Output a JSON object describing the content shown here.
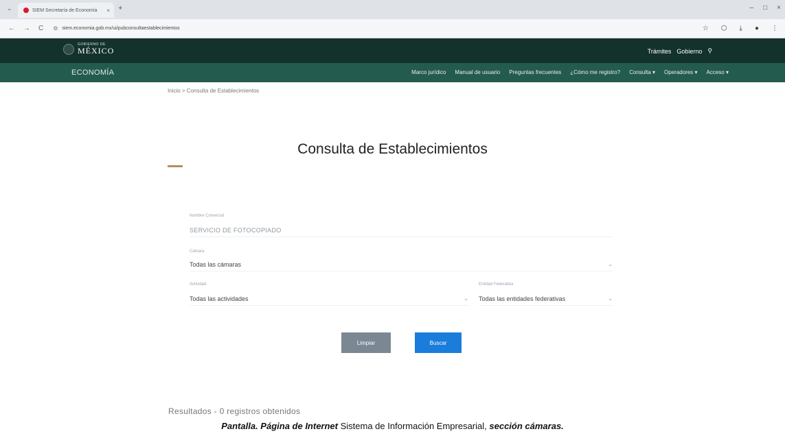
{
  "browser": {
    "tab_title": "SIEM Secretaría de Economía",
    "url": "siem.economia.gob.mx/ui/pubconsultaestablecimientos",
    "new_tab": "+",
    "tab_close": "×",
    "back": "←",
    "forward": "→",
    "reload": "C",
    "star": "☆",
    "extensions": "⬡",
    "download": "⤓",
    "profile": "●",
    "menu": "⋮",
    "min": "–",
    "max": "□",
    "close": "×"
  },
  "gov_header": {
    "logo_small": "GOBIERNO DE",
    "logo_big": "MÉXICO",
    "links": [
      "Trámites",
      "Gobierno"
    ],
    "search_icon": "⚲"
  },
  "subnav": {
    "brand": "ECONOMÍA",
    "menu": [
      "Marco jurídico",
      "Manual de usuario",
      "Preguntas frecuentes",
      "¿Cómo me registro?",
      "Consulta ▾",
      "Operadores ▾",
      "Acceso ▾"
    ]
  },
  "breadcrumb": "Inicio > Consulta de Establecimientos",
  "page_title": "Consulta de Establecimientos",
  "form": {
    "name_label": "Nombre Comercial",
    "name_value": "SERVICIO DE FOTOCOPIADO",
    "chamber_label": "Cámara",
    "chamber_value": "Todas las cámaras",
    "activity_label": "Actividad",
    "activity_value": "Todas las actividades",
    "state_label": "Entidad Federativa",
    "state_value": "Todas las entidades federativas",
    "caret": "⌄"
  },
  "buttons": {
    "clear": "Limpiar",
    "search": "Buscar"
  },
  "results": "Resultados - 0 registros obtenidos",
  "caption": {
    "part1": "Pantalla. Página de Internet",
    "part2": " Sistema de Información Empresarial, ",
    "part3": "sección cámaras."
  }
}
